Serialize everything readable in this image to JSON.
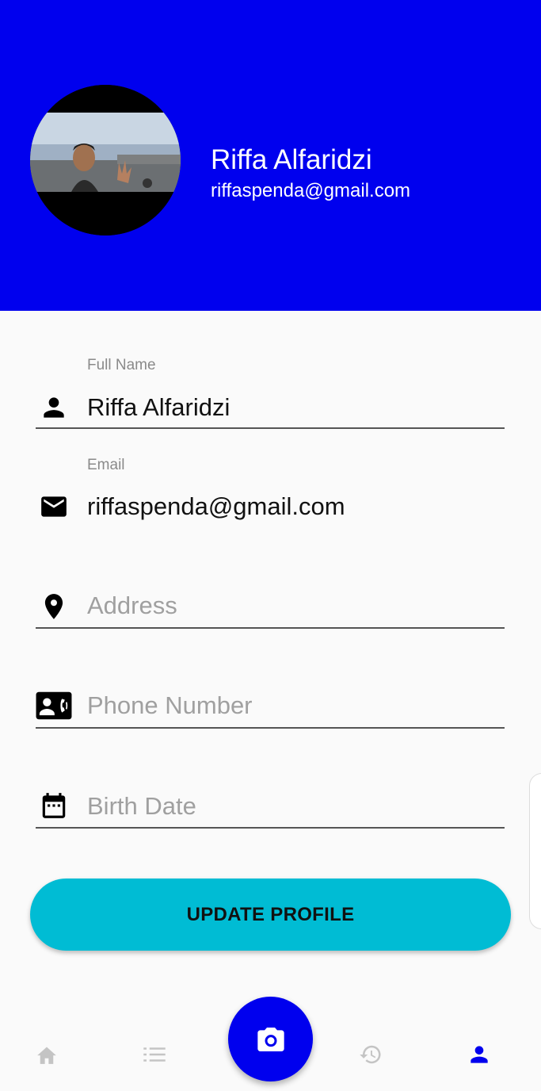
{
  "profile": {
    "name": "Riffa Alfaridzi",
    "email": "riffaspenda@gmail.com"
  },
  "form": {
    "full_name": {
      "label": "Full Name",
      "value": "Riffa Alfaridzi",
      "icon": "person-icon"
    },
    "email": {
      "label": "Email",
      "value": "riffaspenda@gmail.com",
      "icon": "mail-icon"
    },
    "address": {
      "placeholder": "Address",
      "icon": "location-pin-icon"
    },
    "phone": {
      "placeholder": "Phone Number",
      "icon": "contact-phone-icon"
    },
    "birth_date": {
      "placeholder": "Birth Date",
      "icon": "calendar-icon"
    }
  },
  "update_button_label": "UPDATE PROFILE",
  "nav": {
    "items": [
      {
        "name": "home",
        "icon": "home-icon",
        "active": false
      },
      {
        "name": "list",
        "icon": "list-icon",
        "active": false
      },
      {
        "name": "camera",
        "icon": "camera-icon",
        "active": false
      },
      {
        "name": "history",
        "icon": "history-icon",
        "active": false
      },
      {
        "name": "profile",
        "icon": "person-icon",
        "active": true
      }
    ]
  },
  "colors": {
    "header": "#0000ee",
    "accent": "#00bcd4",
    "nav_inactive": "#c4c4c4",
    "nav_active": "#0000ee"
  }
}
